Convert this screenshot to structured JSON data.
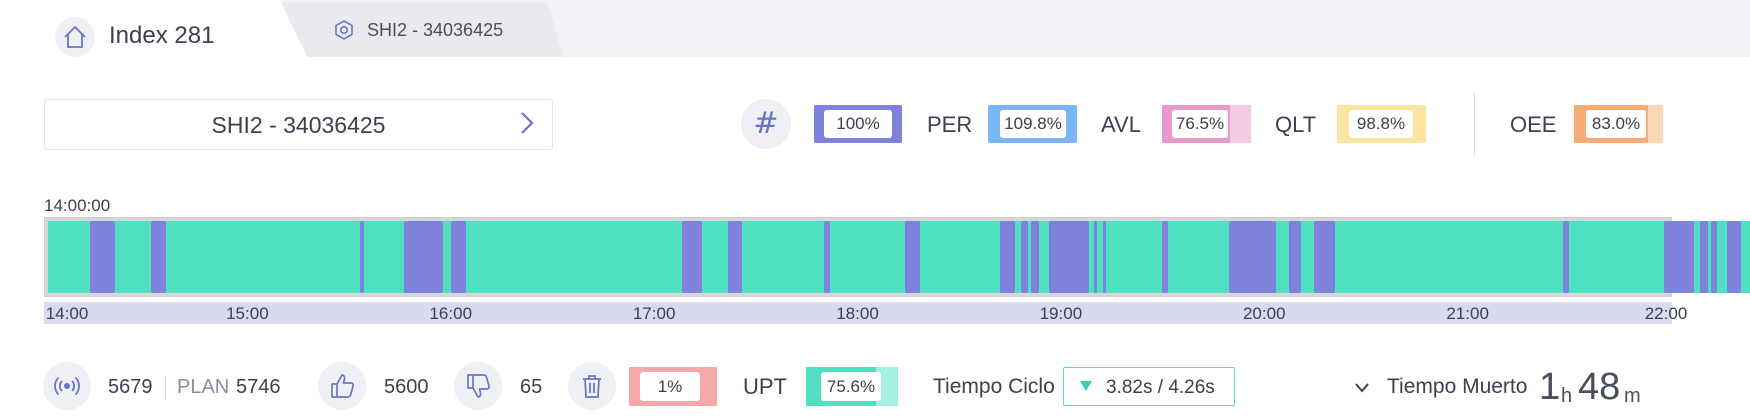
{
  "tabs": {
    "home_label": "Index 281",
    "machine_tab_label": "SHI2 - 34036425"
  },
  "selector": {
    "label": "SHI2 - 34036425"
  },
  "kpis": {
    "hash": "#",
    "total": "100%",
    "per_label": "PER",
    "per_value": "109.8%",
    "avl_label": "AVL",
    "avl_value": "76.5%",
    "qlt_label": "QLT",
    "qlt_value": "98.8%",
    "oee_label": "OEE",
    "oee_value": "83.0%"
  },
  "timeline": {
    "start_label": "14:00:00",
    "ticks": [
      "14:00",
      "15:00",
      "16:00",
      "17:00",
      "18:00",
      "19:00",
      "20:00",
      "21:00",
      "22:00"
    ],
    "colors": {
      "running": "#4fe0c2",
      "stopped": "#7f82dc",
      "current": "#c18af0",
      "empty": "#d7d7d7"
    },
    "stops_hours": [
      [
        0.205,
        0.33
      ],
      [
        0.51,
        0.585
      ],
      [
        1.54,
        1.56
      ],
      [
        1.76,
        1.95
      ],
      [
        1.99,
        2.065
      ],
      [
        3.13,
        3.23
      ],
      [
        3.36,
        3.425
      ],
      [
        3.83,
        3.86
      ],
      [
        4.23,
        4.305
      ],
      [
        4.7,
        4.775
      ],
      [
        4.805,
        4.84
      ],
      [
        4.855,
        4.895
      ],
      [
        4.945,
        5.14
      ],
      [
        5.165,
        5.18
      ],
      [
        5.21,
        5.225
      ],
      [
        5.5,
        5.53
      ],
      [
        5.83,
        6.065
      ],
      [
        6.13,
        6.19
      ],
      [
        6.25,
        6.355
      ],
      [
        7.48,
        7.51
      ],
      [
        7.98,
        8.13
      ],
      [
        8.16,
        8.2
      ],
      [
        8.21,
        8.24
      ],
      [
        8.29,
        8.36
      ],
      [
        8.54,
        8.575
      ]
    ],
    "data_end_hours": 8.6,
    "current_end_hours": 8.74
  },
  "stats": {
    "total_count": "5679",
    "plan_label": "PLAN",
    "plan_value": "5746",
    "good": "5600",
    "bad": "65",
    "scrap_pct": "1%",
    "upt_label": "UPT",
    "upt_value": "75.6%",
    "ciclo_label": "Tiempo Ciclo",
    "ciclo_value": "3.82s  /  4.26s",
    "muerto_label": "Tiempo Muerto",
    "muerto_hours": "1",
    "muerto_hours_unit": "h",
    "muerto_minutes": "48",
    "muerto_minutes_unit": "m"
  },
  "fills": {
    "per": 1.0,
    "avl": 0.765,
    "qlt": 0.988,
    "oee": 0.83,
    "upt": 0.756
  },
  "icons": [
    "home-icon",
    "hexagon-icon",
    "chevron-right-icon",
    "signal-icon",
    "thumbs-up-icon",
    "thumbs-down-icon",
    "trash-icon",
    "chevron-down-icon"
  ]
}
